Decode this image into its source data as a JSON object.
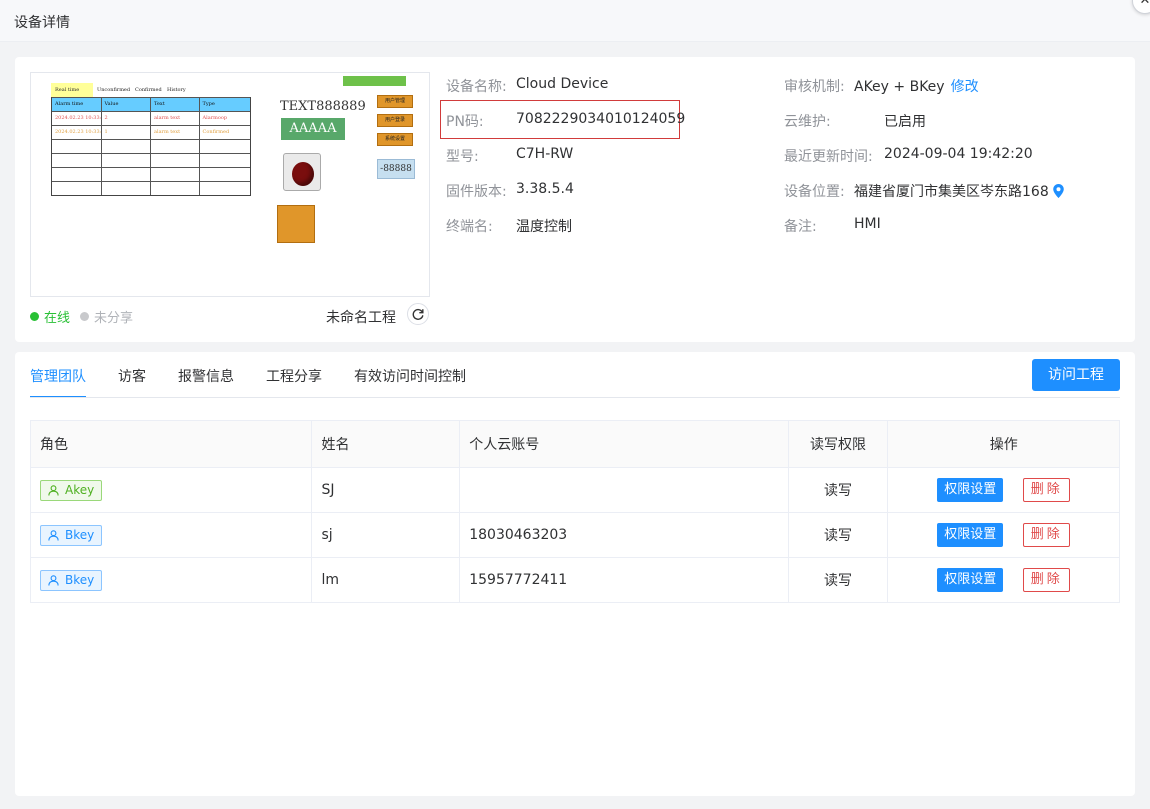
{
  "dialog": {
    "title": "设备详情",
    "close_label": "✕"
  },
  "preview": {
    "hmi": {
      "tab_realtime": "Real time",
      "tab_unconfirmed": "Unconfirmed",
      "tab_confirmed": "Confirmed",
      "tab_history": "History",
      "headers": [
        "Alarm time",
        "Value",
        "Text",
        "Type"
      ],
      "rows": [
        [
          "2024.02.23 10:33:54",
          "2",
          "alarm text",
          "Alarmoop"
        ],
        [
          "2024.02.23 10:33:55",
          "1",
          "alarm text",
          "Confirmed"
        ]
      ],
      "text_label": "TEXT888889",
      "green_label": "AAAAA",
      "btn_user_mgmt": "用户管理",
      "btn_user_login": "用户登录",
      "btn_sys_settings": "系统设置",
      "num_display": "-88888"
    },
    "status_online": "在线",
    "status_share": "未分享",
    "project_name": "未命名工程"
  },
  "info": {
    "device_name_label": "设备名称:",
    "device_name": "Cloud Device",
    "pn_label": "PN码:",
    "pn": "708222903401012405​9",
    "model_label": "型号:",
    "model": "C7H-RW",
    "firmware_label": "固件版本:",
    "firmware": "3.38.5.4",
    "terminal_label": "终端名:",
    "terminal": "温度控制",
    "audit_label": "审核机制:",
    "audit": "AKey + BKey",
    "audit_edit": "修改",
    "cloud_label": "云维护:",
    "cloud": "已启用",
    "updated_label": "最近更新时间:",
    "updated": "2024-09-04 19:42:20",
    "location_label": "设备位置:",
    "location": "福建省厦门市集美区岑东路168",
    "remark_label": "备注:",
    "remark": "HMI"
  },
  "tabs": [
    "管理团队",
    "访客",
    "报警信息",
    "工程分享",
    "有效访问时间控制"
  ],
  "visit_button": "访问工程",
  "table": {
    "headers": [
      "角色",
      "姓名",
      "个人云账号",
      "读写权限",
      "操作"
    ],
    "rows": [
      {
        "role": "Akey",
        "name": "SJ",
        "account": "",
        "perm": "读写"
      },
      {
        "role": "Bkey",
        "name": "sj",
        "account": "18030463203",
        "perm": "读写"
      },
      {
        "role": "Bkey",
        "name": "lm",
        "account": "15957772411",
        "perm": "读写"
      }
    ],
    "perm_button": "权限设置",
    "delete_button": "删除"
  },
  "colors": {
    "primary": "#1e8fff",
    "online": "#29c035",
    "danger": "#e04a4a",
    "highlight_box": "#d13b3b"
  }
}
